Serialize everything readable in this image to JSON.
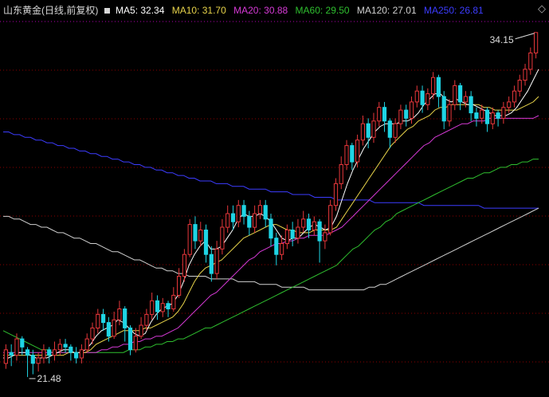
{
  "legend": {
    "title": "山东黄金(日线,前复权)",
    "ma5": "MA5: 32.34",
    "ma10": "MA10: 31.70",
    "ma20": "MA20: 30.88",
    "ma60": "MA60: 29.50",
    "ma120": "MA120: 27.01",
    "ma250": "MA250: 26.81"
  },
  "colors": {
    "up": "#e8373b",
    "down": "#1fd4e4",
    "ma5": "#ffffff",
    "ma10": "#e7d34a",
    "ma20": "#d63ad6",
    "ma60": "#2fbf2f",
    "ma120": "#cfcfcf",
    "ma250": "#3c3cff",
    "grid": "#8b0000",
    "text": "#cccccc"
  },
  "controls": {
    "toggle_icon": "diamond-icon"
  },
  "chart_data": {
    "type": "candlestick",
    "title": "山东黄金(日线,前复权)",
    "high_label": "34.15",
    "low_label": "21.48",
    "ylim": [
      21.0,
      34.7
    ],
    "grid": true,
    "candles": [
      [
        22.0,
        22.5,
        21.8,
        22.7
      ],
      [
        22.4,
        22.3,
        21.9,
        22.7
      ],
      [
        22.3,
        22.9,
        22.1,
        23.1
      ],
      [
        22.9,
        22.6,
        22.3,
        23.0
      ],
      [
        22.5,
        22.3,
        21.5,
        22.6
      ],
      [
        22.3,
        22.0,
        21.6,
        22.5
      ],
      [
        22.0,
        22.2,
        21.7,
        22.4
      ],
      [
        22.2,
        22.5,
        22.0,
        22.7
      ],
      [
        22.5,
        22.3,
        22.0,
        22.6
      ],
      [
        22.3,
        22.5,
        22.1,
        22.8
      ],
      [
        22.5,
        22.7,
        22.3,
        22.9
      ],
      [
        22.7,
        22.6,
        22.4,
        22.9
      ],
      [
        22.6,
        22.4,
        22.1,
        22.7
      ],
      [
        22.4,
        22.2,
        22.0,
        22.6
      ],
      [
        22.2,
        22.5,
        22.0,
        22.7
      ],
      [
        22.5,
        22.9,
        22.4,
        23.1
      ],
      [
        22.9,
        23.3,
        22.7,
        23.5
      ],
      [
        23.3,
        23.8,
        23.1,
        24.0
      ],
      [
        23.8,
        23.5,
        23.2,
        24.0
      ],
      [
        23.5,
        23.0,
        22.8,
        23.7
      ],
      [
        23.0,
        23.6,
        22.9,
        23.9
      ],
      [
        23.6,
        24.0,
        23.4,
        24.3
      ],
      [
        24.0,
        23.3,
        22.8,
        24.1
      ],
      [
        23.3,
        22.5,
        22.3,
        23.4
      ],
      [
        22.5,
        23.0,
        22.4,
        23.3
      ],
      [
        23.0,
        23.4,
        22.9,
        23.7
      ],
      [
        23.4,
        23.8,
        23.2,
        24.0
      ],
      [
        23.8,
        24.3,
        23.6,
        24.6
      ],
      [
        24.3,
        23.9,
        23.6,
        24.5
      ],
      [
        23.9,
        24.2,
        23.7,
        24.4
      ],
      [
        24.2,
        24.0,
        23.7,
        24.3
      ],
      [
        24.0,
        24.5,
        23.9,
        24.8
      ],
      [
        24.5,
        25.2,
        24.4,
        25.5
      ],
      [
        25.2,
        26.0,
        25.0,
        26.2
      ],
      [
        26.0,
        27.1,
        25.9,
        27.3
      ],
      [
        27.1,
        26.5,
        26.2,
        27.4
      ],
      [
        26.5,
        26.9,
        26.3,
        27.2
      ],
      [
        26.9,
        26.0,
        25.7,
        27.1
      ],
      [
        26.0,
        25.3,
        25.0,
        26.3
      ],
      [
        25.3,
        26.2,
        25.1,
        26.5
      ],
      [
        26.2,
        27.0,
        26.0,
        27.3
      ],
      [
        27.0,
        27.5,
        26.8,
        27.8
      ],
      [
        27.5,
        27.2,
        26.9,
        27.8
      ],
      [
        27.2,
        27.8,
        27.0,
        28.0
      ],
      [
        27.8,
        27.4,
        27.1,
        28.0
      ],
      [
        27.4,
        27.0,
        26.7,
        27.6
      ],
      [
        27.0,
        27.5,
        26.8,
        27.8
      ],
      [
        27.5,
        27.8,
        27.3,
        28.0
      ],
      [
        27.8,
        27.3,
        27.0,
        28.0
      ],
      [
        27.3,
        26.6,
        26.3,
        27.5
      ],
      [
        26.6,
        26.0,
        25.6,
        26.8
      ],
      [
        26.0,
        26.4,
        25.8,
        26.7
      ],
      [
        26.4,
        26.9,
        26.2,
        27.1
      ],
      [
        26.9,
        26.6,
        26.3,
        27.2
      ],
      [
        26.6,
        27.0,
        26.4,
        27.3
      ],
      [
        27.0,
        27.3,
        26.8,
        27.6
      ],
      [
        27.3,
        26.9,
        26.6,
        27.5
      ],
      [
        26.9,
        27.2,
        26.7,
        27.4
      ],
      [
        27.2,
        26.5,
        25.7,
        27.3
      ],
      [
        26.5,
        26.8,
        26.2,
        27.1
      ],
      [
        26.8,
        27.8,
        26.7,
        28.0
      ],
      [
        27.8,
        28.6,
        27.6,
        28.8
      ],
      [
        28.6,
        29.3,
        28.4,
        29.6
      ],
      [
        29.3,
        30.0,
        29.1,
        30.2
      ],
      [
        30.0,
        29.4,
        29.1,
        30.1
      ],
      [
        29.4,
        30.2,
        29.2,
        30.4
      ],
      [
        30.2,
        30.8,
        30.0,
        31.1
      ],
      [
        30.8,
        30.3,
        29.9,
        31.0
      ],
      [
        30.3,
        30.9,
        30.1,
        31.2
      ],
      [
        30.9,
        31.4,
        30.7,
        31.6
      ],
      [
        31.4,
        30.9,
        30.5,
        31.6
      ],
      [
        30.9,
        30.3,
        29.9,
        31.0
      ],
      [
        30.3,
        30.8,
        30.1,
        31.0
      ],
      [
        30.8,
        31.3,
        30.6,
        31.5
      ],
      [
        31.3,
        31.0,
        30.7,
        31.5
      ],
      [
        31.0,
        31.6,
        30.8,
        31.8
      ],
      [
        31.6,
        32.0,
        31.4,
        32.2
      ],
      [
        32.0,
        31.5,
        31.2,
        32.2
      ],
      [
        31.5,
        31.9,
        31.3,
        32.1
      ],
      [
        31.9,
        32.5,
        31.7,
        32.7
      ],
      [
        32.5,
        31.8,
        31.4,
        32.6
      ],
      [
        31.8,
        30.9,
        30.6,
        32.0
      ],
      [
        30.9,
        31.5,
        30.7,
        31.7
      ],
      [
        31.5,
        32.2,
        31.3,
        32.4
      ],
      [
        32.2,
        31.6,
        31.3,
        32.3
      ],
      [
        31.6,
        31.8,
        31.4,
        32.0
      ],
      [
        31.8,
        31.2,
        30.9,
        32.0
      ],
      [
        31.2,
        31.0,
        30.7,
        31.4
      ],
      [
        31.0,
        31.3,
        30.8,
        31.5
      ],
      [
        31.3,
        30.8,
        30.5,
        31.4
      ],
      [
        30.8,
        31.2,
        30.6,
        31.4
      ],
      [
        31.2,
        31.0,
        30.7,
        31.3
      ],
      [
        31.0,
        31.4,
        30.8,
        31.6
      ],
      [
        31.4,
        31.6,
        31.2,
        31.8
      ],
      [
        31.6,
        32.0,
        31.4,
        32.2
      ],
      [
        32.0,
        32.4,
        31.8,
        32.6
      ],
      [
        32.4,
        32.8,
        32.2,
        33.0
      ],
      [
        32.8,
        33.4,
        32.6,
        33.6
      ],
      [
        33.4,
        34.15,
        33.2,
        34.15
      ]
    ],
    "ma5": [
      22.2,
      22.2,
      22.3,
      22.4,
      22.4,
      22.3,
      22.2,
      22.2,
      22.2,
      22.3,
      22.4,
      22.5,
      22.5,
      22.4,
      22.4,
      22.5,
      22.7,
      23.0,
      23.2,
      23.3,
      23.4,
      23.6,
      23.5,
      23.3,
      23.1,
      23.0,
      23.1,
      23.5,
      23.8,
      24.0,
      24.1,
      24.2,
      24.5,
      25.0,
      25.6,
      26.0,
      26.3,
      26.5,
      26.2,
      26.2,
      26.3,
      26.6,
      26.9,
      27.3,
      27.5,
      27.4,
      27.4,
      27.5,
      27.4,
      27.2,
      26.9,
      26.6,
      26.5,
      26.6,
      26.6,
      26.8,
      27.0,
      27.1,
      27.0,
      26.9,
      27.0,
      27.4,
      28.0,
      28.6,
      29.1,
      29.5,
      29.9,
      30.2,
      30.5,
      30.7,
      30.8,
      30.8,
      30.8,
      30.9,
      30.9,
      31.0,
      31.2,
      31.5,
      31.7,
      31.9,
      31.9,
      31.7,
      31.6,
      31.7,
      31.6,
      31.5,
      31.5,
      31.4,
      31.3,
      31.2,
      31.1,
      31.1,
      31.1,
      31.2,
      31.4,
      31.7,
      32.0,
      32.4,
      32.8
    ],
    "ma10": [
      22.3,
      22.3,
      22.3,
      22.3,
      22.3,
      22.3,
      22.3,
      22.3,
      22.3,
      22.3,
      22.3,
      22.3,
      22.4,
      22.4,
      22.4,
      22.4,
      22.5,
      22.7,
      22.8,
      22.9,
      23.0,
      23.1,
      23.2,
      23.2,
      23.2,
      23.2,
      23.3,
      23.3,
      23.4,
      23.5,
      23.6,
      23.7,
      23.9,
      24.2,
      24.6,
      25.0,
      25.3,
      25.5,
      25.6,
      25.7,
      25.8,
      26.0,
      26.2,
      26.4,
      26.6,
      26.7,
      26.8,
      26.9,
      27.0,
      27.1,
      27.1,
      27.0,
      26.9,
      26.9,
      26.8,
      26.8,
      26.8,
      26.9,
      26.9,
      26.9,
      26.9,
      27.0,
      27.3,
      27.6,
      27.9,
      28.2,
      28.5,
      28.8,
      29.1,
      29.4,
      29.7,
      30.0,
      30.2,
      30.4,
      30.6,
      30.7,
      30.9,
      31.0,
      31.1,
      31.3,
      31.4,
      31.4,
      31.5,
      31.5,
      31.5,
      31.5,
      31.5,
      31.5,
      31.4,
      31.4,
      31.3,
      31.3,
      31.3,
      31.3,
      31.3,
      31.4,
      31.5,
      31.6,
      31.8
    ],
    "ma20": [
      22.4,
      22.4,
      22.4,
      22.4,
      22.4,
      22.4,
      22.4,
      22.4,
      22.4,
      22.4,
      22.4,
      22.4,
      22.4,
      22.4,
      22.4,
      22.4,
      22.4,
      22.4,
      22.5,
      22.5,
      22.6,
      22.6,
      22.7,
      22.7,
      22.8,
      22.8,
      22.9,
      22.9,
      23.0,
      23.0,
      23.1,
      23.2,
      23.3,
      23.5,
      23.7,
      23.9,
      24.1,
      24.3,
      24.5,
      24.6,
      24.8,
      25.0,
      25.2,
      25.4,
      25.6,
      25.8,
      25.9,
      26.1,
      26.2,
      26.3,
      26.4,
      26.4,
      26.5,
      26.5,
      26.6,
      26.6,
      26.7,
      26.7,
      26.7,
      26.7,
      26.8,
      26.9,
      27.0,
      27.2,
      27.4,
      27.6,
      27.8,
      28.0,
      28.2,
      28.4,
      28.6,
      28.8,
      29.0,
      29.2,
      29.4,
      29.6,
      29.8,
      30.0,
      30.1,
      30.3,
      30.4,
      30.5,
      30.6,
      30.7,
      30.8,
      30.8,
      30.9,
      30.9,
      30.9,
      31.0,
      31.0,
      31.0,
      31.0,
      31.0,
      31.0,
      31.0,
      31.0,
      31.0,
      31.1
    ],
    "ma60": [
      23.2,
      23.1,
      23.0,
      22.9,
      22.8,
      22.7,
      22.6,
      22.5,
      22.5,
      22.4,
      22.4,
      22.4,
      22.4,
      22.4,
      22.4,
      22.4,
      22.4,
      22.4,
      22.4,
      22.4,
      22.4,
      22.4,
      22.4,
      22.5,
      22.5,
      22.5,
      22.6,
      22.6,
      22.7,
      22.7,
      22.8,
      22.8,
      22.9,
      22.9,
      23.0,
      23.1,
      23.2,
      23.3,
      23.3,
      23.4,
      23.5,
      23.6,
      23.7,
      23.8,
      23.9,
      24.0,
      24.1,
      24.2,
      24.3,
      24.4,
      24.5,
      24.6,
      24.7,
      24.8,
      24.9,
      25.0,
      25.1,
      25.2,
      25.3,
      25.4,
      25.5,
      25.6,
      25.8,
      26.0,
      26.2,
      26.3,
      26.5,
      26.7,
      26.9,
      27.0,
      27.2,
      27.3,
      27.5,
      27.6,
      27.7,
      27.8,
      27.9,
      28.0,
      28.1,
      28.2,
      28.3,
      28.4,
      28.5,
      28.6,
      28.7,
      28.8,
      28.8,
      28.9,
      29.0,
      29.0,
      29.1,
      29.2,
      29.2,
      29.3,
      29.3,
      29.4,
      29.4,
      29.5,
      29.5
    ],
    "ma120": [
      27.4,
      27.4,
      27.3,
      27.3,
      27.2,
      27.1,
      27.1,
      27.0,
      27.0,
      26.9,
      26.8,
      26.8,
      26.7,
      26.6,
      26.6,
      26.5,
      26.4,
      26.4,
      26.3,
      26.2,
      26.1,
      26.1,
      26.0,
      25.9,
      25.8,
      25.8,
      25.7,
      25.6,
      25.5,
      25.5,
      25.4,
      25.4,
      25.3,
      25.3,
      25.2,
      25.2,
      25.2,
      25.2,
      25.1,
      25.1,
      25.1,
      25.1,
      25.1,
      25.0,
      25.0,
      25.0,
      25.0,
      24.9,
      24.9,
      24.9,
      24.9,
      24.8,
      24.8,
      24.8,
      24.8,
      24.8,
      24.7,
      24.7,
      24.7,
      24.7,
      24.7,
      24.7,
      24.7,
      24.7,
      24.7,
      24.7,
      24.7,
      24.8,
      24.8,
      24.9,
      24.9,
      25.0,
      25.1,
      25.2,
      25.3,
      25.4,
      25.5,
      25.6,
      25.7,
      25.8,
      25.9,
      26.0,
      26.1,
      26.2,
      26.3,
      26.4,
      26.5,
      26.6,
      26.7,
      26.8,
      26.9,
      27.0,
      27.1,
      27.2,
      27.3,
      27.4,
      27.5,
      27.6,
      27.7
    ],
    "ma250": [
      30.5,
      30.5,
      30.4,
      30.4,
      30.3,
      30.3,
      30.2,
      30.2,
      30.1,
      30.1,
      30.0,
      30.0,
      29.9,
      29.9,
      29.8,
      29.8,
      29.7,
      29.7,
      29.6,
      29.6,
      29.5,
      29.5,
      29.4,
      29.4,
      29.3,
      29.3,
      29.2,
      29.2,
      29.1,
      29.1,
      29.0,
      29.0,
      28.9,
      28.9,
      28.8,
      28.8,
      28.7,
      28.7,
      28.7,
      28.6,
      28.6,
      28.6,
      28.5,
      28.5,
      28.5,
      28.4,
      28.4,
      28.4,
      28.4,
      28.3,
      28.3,
      28.3,
      28.3,
      28.2,
      28.2,
      28.2,
      28.2,
      28.1,
      28.1,
      28.1,
      28.1,
      28.0,
      28.0,
      28.0,
      28.0,
      28.0,
      28.0,
      28.0,
      27.9,
      27.9,
      27.9,
      27.9,
      27.9,
      27.9,
      27.9,
      27.9,
      27.9,
      27.8,
      27.8,
      27.8,
      27.8,
      27.8,
      27.8,
      27.8,
      27.8,
      27.8,
      27.8,
      27.8,
      27.7,
      27.7,
      27.7,
      27.7,
      27.7,
      27.7,
      27.7,
      27.7,
      27.7,
      27.7,
      27.7
    ]
  }
}
